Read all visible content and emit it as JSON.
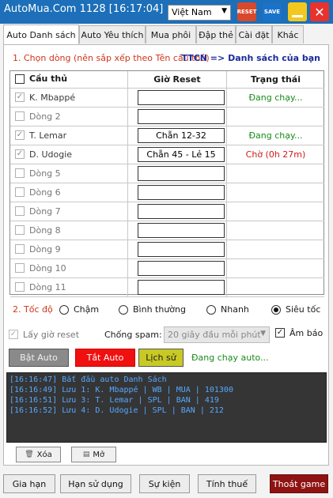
{
  "window": {
    "title": "AutoMua.Com 1128 [16:17:04]",
    "language": "Việt Nam",
    "reset_icon_text": "RESET",
    "save_icon_text": "SAVE",
    "close_symbol": "✕",
    "colors": {
      "titlebar": "#1c6fb8",
      "reset": "#d9482b",
      "save": "#1a73c9",
      "minimize": "#f2c81e",
      "close": "#e8322e"
    }
  },
  "tabs": [
    {
      "label": "Auto Danh sách",
      "active": true
    },
    {
      "label": "Auto Yêu thích"
    },
    {
      "label": "Mua phôi"
    },
    {
      "label": "Đập thẻ"
    },
    {
      "label": "Cài đặt"
    },
    {
      "label": "Khác"
    }
  ],
  "section1": {
    "label": "1. Chọn dòng (nên sắp xếp theo Tên cầu thủ)",
    "link": "TTCN => Danh sách của bạn"
  },
  "grid": {
    "headers": {
      "player": "Cầu thủ",
      "time": "Giờ Reset",
      "status": "Trạng thái"
    },
    "rows": [
      {
        "checked": true,
        "name": "K. Mbappé",
        "time": "",
        "status": "Đang chạy...",
        "status_type": "running"
      },
      {
        "checked": false,
        "name": "Dòng 2",
        "time": "",
        "status": "",
        "status_type": ""
      },
      {
        "checked": true,
        "name": "T. Lemar",
        "time": "Chẵn 12-32",
        "status": "Đang chạy...",
        "status_type": "running"
      },
      {
        "checked": true,
        "name": "D. Udogie",
        "time": "Chẵn 45 - Lẻ 15",
        "status": "Chờ (0h 27m)",
        "status_type": "waiting"
      },
      {
        "checked": false,
        "name": "Dòng 5",
        "time": "",
        "status": "",
        "status_type": ""
      },
      {
        "checked": false,
        "name": "Dòng 6",
        "time": "",
        "status": "",
        "status_type": ""
      },
      {
        "checked": false,
        "name": "Dòng 7",
        "time": "",
        "status": "",
        "status_type": ""
      },
      {
        "checked": false,
        "name": "Dòng 8",
        "time": "",
        "status": "",
        "status_type": ""
      },
      {
        "checked": false,
        "name": "Dòng 9",
        "time": "",
        "status": "",
        "status_type": ""
      },
      {
        "checked": false,
        "name": "Dòng 10",
        "time": "",
        "status": "",
        "status_type": ""
      },
      {
        "checked": false,
        "name": "Dòng 11",
        "time": "",
        "status": "",
        "status_type": ""
      }
    ]
  },
  "speed": {
    "label": "2. Tốc độ",
    "options": [
      {
        "label": "Chậm",
        "selected": false
      },
      {
        "label": "Bình thường",
        "selected": false
      },
      {
        "label": "Nhanh",
        "selected": false
      },
      {
        "label": "Siêu tốc",
        "selected": true
      }
    ]
  },
  "options": {
    "reset_time_label": "Lấy giờ reset",
    "reset_time_checked": true,
    "spam_label": "Chống spam:",
    "spam_value": "20 giây đầu mỗi phút",
    "sound_label": "Âm báo",
    "sound_checked": true
  },
  "actions": {
    "start": "Bật Auto",
    "stop": "Tắt Auto",
    "history": "Lịch sử",
    "status": "Đang chạy auto..."
  },
  "log": [
    "[16:16:47] Bắt đầu auto Danh Sách",
    "[16:16:49] Lưu 1: K. Mbappé | WB | MUA | 101300",
    "[16:16:51] Lưu 3: T. Lemar | SPL | BAN | 419",
    "[16:16:52] Lưu 4: D. Udogie | SPL | BAN | 212"
  ],
  "log_buttons": {
    "clear": "Xóa",
    "open": "Mở"
  },
  "footer": {
    "extend": "Gia hạn",
    "expiry": "Hạn sử dụng",
    "events": "Sự kiện",
    "tax": "Tính thuế",
    "exit": "Thoát game"
  }
}
